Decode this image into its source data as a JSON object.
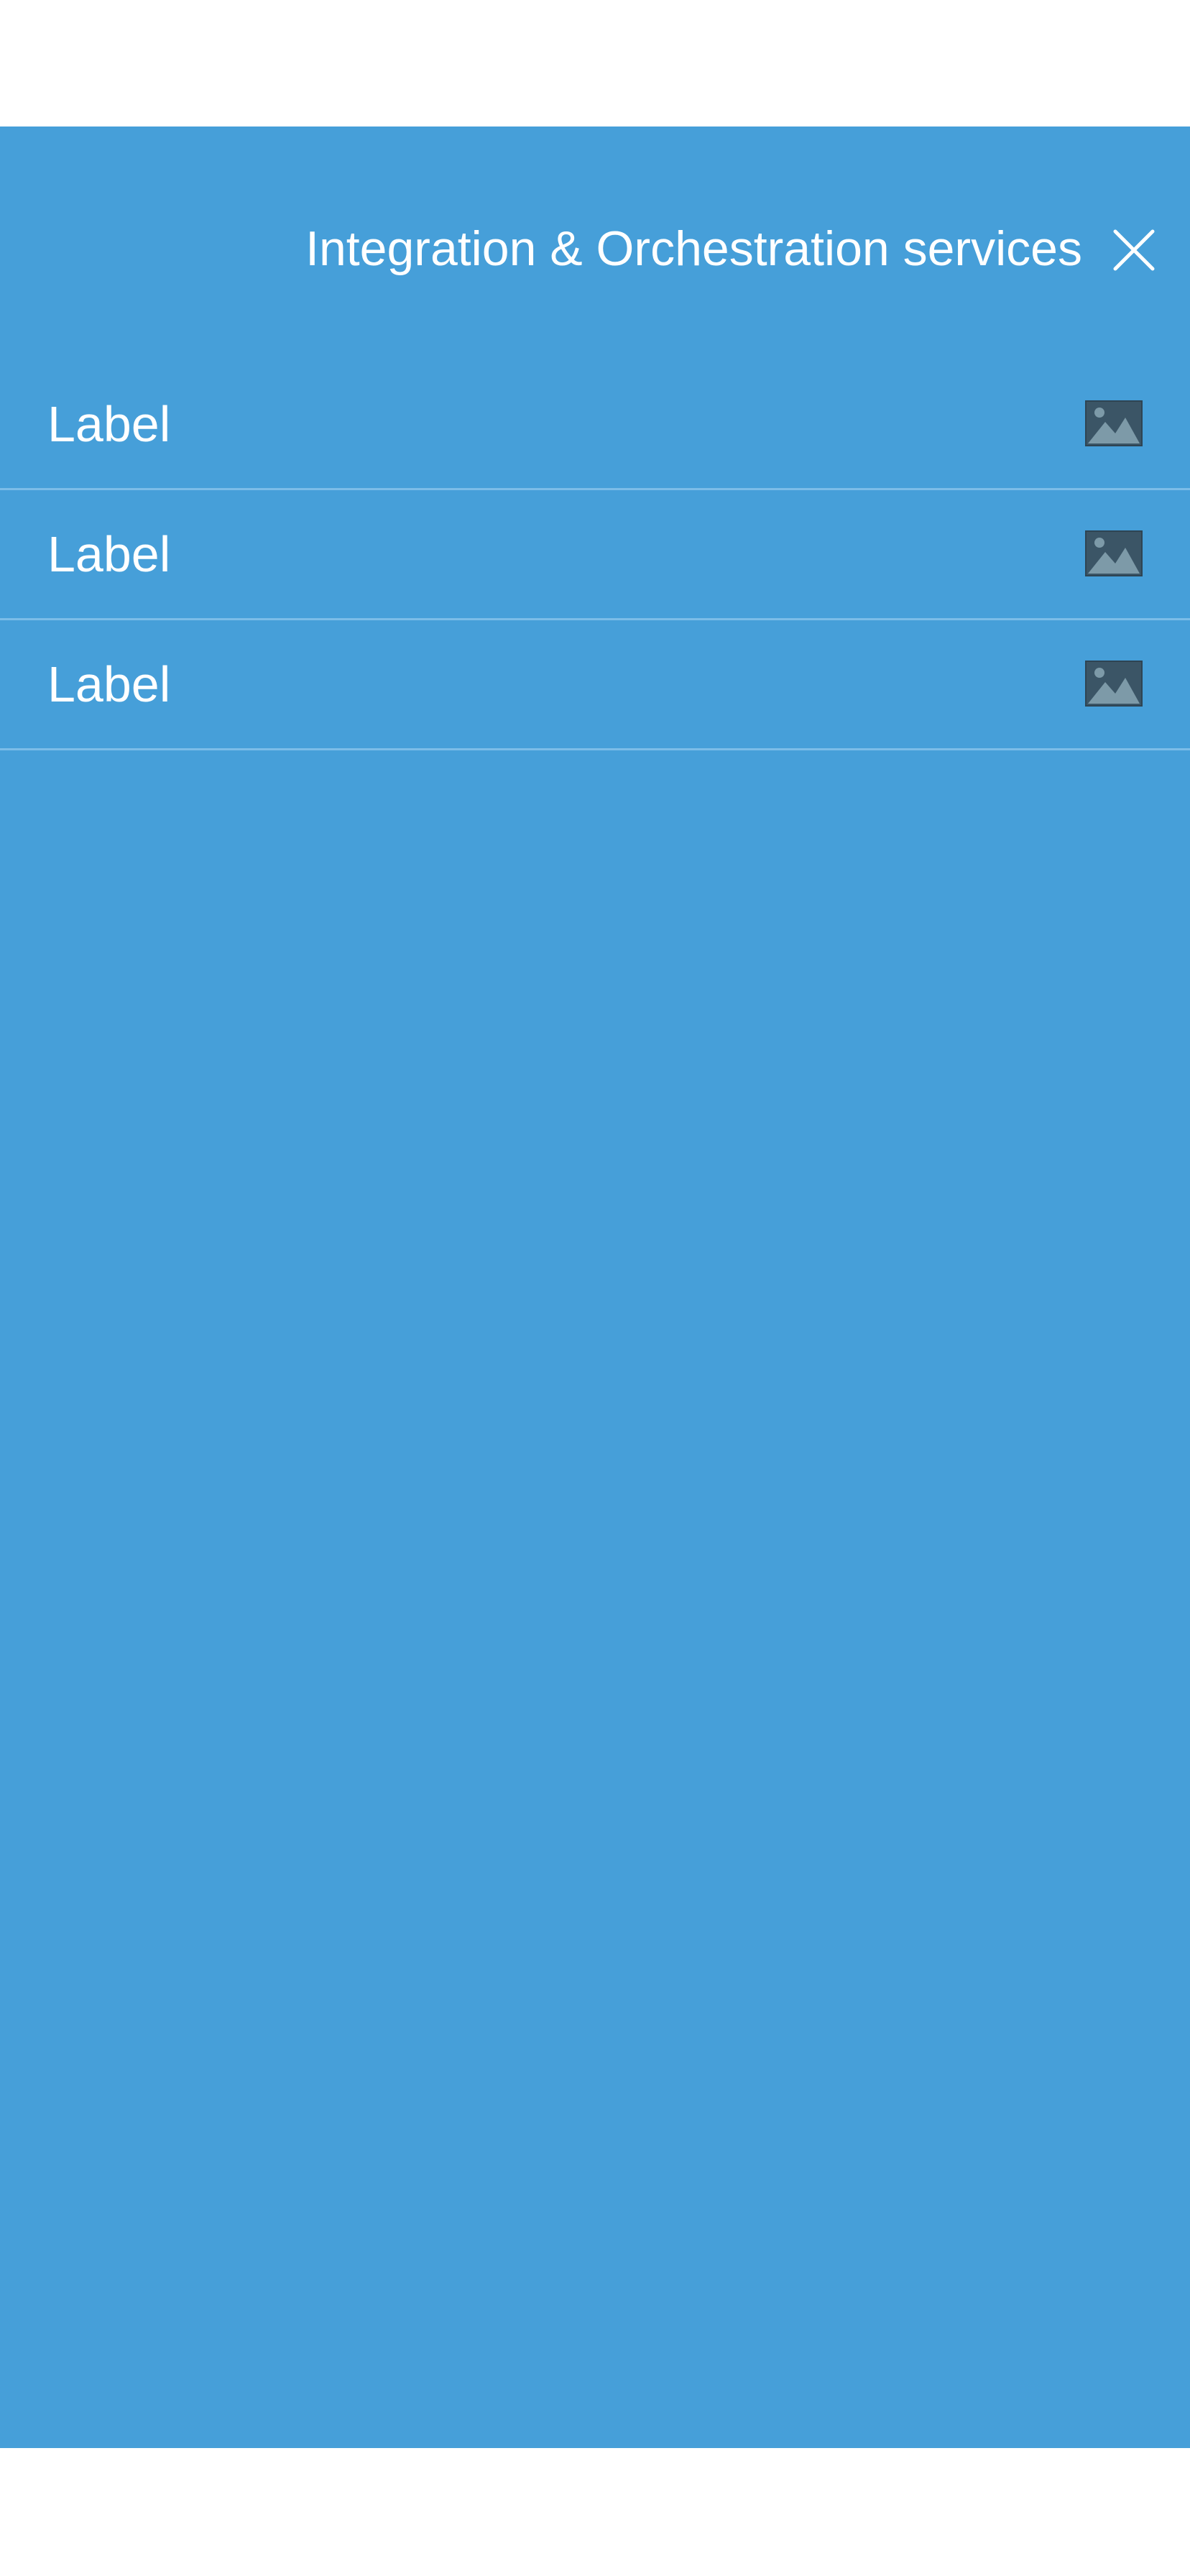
{
  "header": {
    "title": "Integration & Orchestration services",
    "close_icon": "close-icon"
  },
  "list": {
    "items": [
      {
        "label": "Label",
        "icon": "image-placeholder-icon"
      },
      {
        "label": "Label",
        "icon": "image-placeholder-icon"
      },
      {
        "label": "Label",
        "icon": "image-placeholder-icon"
      }
    ]
  },
  "colors": {
    "panel_background": "#469fd9",
    "divider": "#7cbde8",
    "text": "#ffffff",
    "icon_frame": "#3b5566",
    "icon_mountain": "#7d9aa8"
  }
}
